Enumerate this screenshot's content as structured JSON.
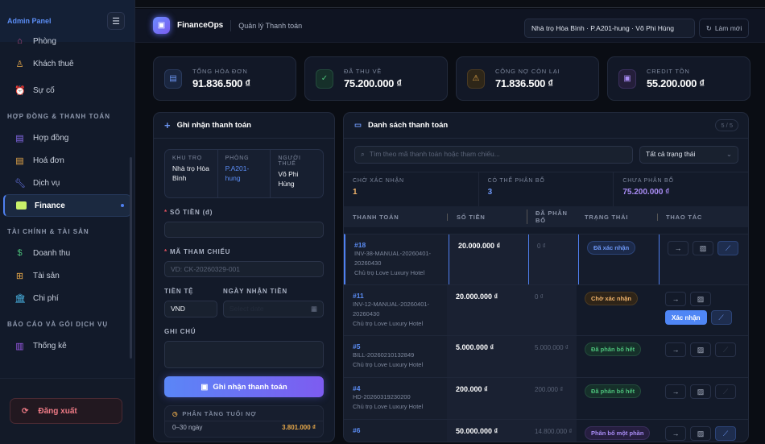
{
  "sidebar": {
    "title": "Admin Panel",
    "items_top": [
      {
        "label": "Phòng",
        "icon": "home-icon"
      },
      {
        "label": "Khách thuê",
        "icon": "user-icon"
      },
      {
        "label": "Sự cố",
        "icon": "alarm-icon"
      }
    ],
    "sections": [
      {
        "title": "HỢP ĐỒNG & THANH TOÁN",
        "items": [
          {
            "label": "Hợp đồng"
          },
          {
            "label": "Hoá đơn"
          },
          {
            "label": "Dịch vụ"
          },
          {
            "label": "Finance"
          }
        ]
      },
      {
        "title": "TÀI CHÍNH & TÀI SẢN",
        "items": [
          {
            "label": "Doanh thu"
          },
          {
            "label": "Tài sản"
          },
          {
            "label": "Chi phí"
          }
        ]
      },
      {
        "title": "BÁO CÁO VÀ GÓI DỊCH VỤ",
        "items": [
          {
            "label": "Thống kê"
          }
        ]
      }
    ],
    "logout": "Đăng xuất"
  },
  "header": {
    "brand": "FinanceOps",
    "subtitle": "Quản lý Thanh toán",
    "context": "Nhà trọ Hòa Bình · P.A201-hung · Võ Phi Hùng",
    "refresh": "Làm mới"
  },
  "stats": [
    {
      "label": "TỔNG HÓA ĐƠN",
      "value": "91.836.500 ₫"
    },
    {
      "label": "ĐÃ THU VỀ",
      "value": "75.200.000 ₫"
    },
    {
      "label": "CÔNG NỢ CÒN LẠI",
      "value": "71.836.500 ₫"
    },
    {
      "label": "CREDIT TỒN",
      "value": "55.200.000 ₫"
    }
  ],
  "form": {
    "title": "Ghi nhận thanh toán",
    "ctx": [
      {
        "k": "KHU TRỌ",
        "v": "Nhà trọ Hòa Bình"
      },
      {
        "k": "PHÒNG",
        "v": "P.A201-hung"
      },
      {
        "k": "NGƯỜI THUÊ",
        "v": "Võ Phi Hùng"
      }
    ],
    "amount_label": "SỐ TIỀN (đ)",
    "ref_label": "MÃ THAM CHIẾU",
    "ref_placeholder": "VD: CK-20260329-001",
    "currency_label": "TIỀN TỆ",
    "currency": "VND",
    "date_label": "NGÀY NHẬN TIỀN",
    "date_placeholder": "Select date",
    "note_label": "GHI CHÚ",
    "submit": "Ghi nhận thanh toán",
    "aging_title": "PHÂN TẦNG TUỔI NỢ",
    "aging_rows": [
      {
        "label": "0–30 ngày",
        "value": "3.801.000 ₫"
      }
    ]
  },
  "list": {
    "title": "Danh sách thanh toán",
    "count": "5 / 5",
    "search_placeholder": "Tìm theo mã thanh toán hoặc tham chiếu...",
    "filter": "Tất cả trạng thái",
    "summary": [
      {
        "label": "CHỜ XÁC NHẬN",
        "value": "1",
        "color": "#f0b36a"
      },
      {
        "label": "CÓ THỂ PHÂN BỔ",
        "value": "3",
        "color": "#6d97f5"
      },
      {
        "label": "CHƯA PHÂN BỔ",
        "value": "75.200.000 ₫",
        "color": "#a98cf5"
      }
    ],
    "columns": [
      "THANH TOÁN",
      "SỐ TIỀN",
      "ĐÃ PHÂN BỔ",
      "TRẠNG THÁI",
      "THAO TÁC"
    ],
    "confirm": "Xác nhận",
    "rows": [
      {
        "id": "#18",
        "ref": "INV-38-MANUAL-20260401-20260430",
        "owner": "Chủ trọ Love Luxury Hotel",
        "amount": "20.000.000 ₫",
        "allocated": "0 ₫",
        "status": "Đã xác nhận"
      },
      {
        "id": "#11",
        "ref": "INV-12-MANUAL-20260401-20260430",
        "owner": "Chủ trọ Love Luxury Hotel",
        "amount": "20.000.000 ₫",
        "allocated": "0 ₫",
        "status": "Chờ xác nhận"
      },
      {
        "id": "#5",
        "ref": "BILL-20260210132849",
        "owner": "Chủ trọ Love Luxury Hotel",
        "amount": "5.000.000 ₫",
        "allocated": "5.000.000 ₫",
        "status": "Đã phân bổ hết"
      },
      {
        "id": "#4",
        "ref": "HD-20260319230200",
        "owner": "Chủ trọ Love Luxury Hotel",
        "amount": "200.000 ₫",
        "allocated": "200.000 ₫",
        "status": "Đã phân bổ hết"
      },
      {
        "id": "#6",
        "ref": "",
        "owner": "",
        "amount": "50.000.000 ₫",
        "allocated": "14.800.000 ₫",
        "status": "Phân bổ một phần"
      }
    ]
  }
}
